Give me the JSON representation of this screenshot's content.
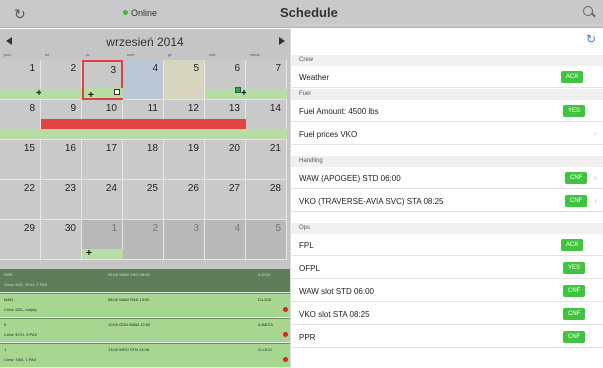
{
  "header": {
    "online_label": "Online",
    "title": "Schedule",
    "refresh_icon": "refresh-icon",
    "search_icon": "search-icon"
  },
  "calendar": {
    "month": "wrzesień 2014",
    "weekdays": [
      "pon.",
      "wt.",
      "śr.",
      "czw.",
      "pt.",
      "sob.",
      "niedz."
    ],
    "weeks": [
      [
        "1",
        "2",
        "3",
        "4",
        "5",
        "6",
        "7"
      ],
      [
        "8",
        "9",
        "10",
        "11",
        "12",
        "13",
        "14"
      ],
      [
        "15",
        "16",
        "17",
        "18",
        "19",
        "20",
        "21"
      ],
      [
        "22",
        "23",
        "24",
        "25",
        "26",
        "27",
        "28"
      ],
      [
        "29",
        "30",
        "1",
        "2",
        "3",
        "4",
        "5"
      ]
    ]
  },
  "flights": [
    {
      "reg": "RAR",
      "sub": "Crew: DEL, ECH, 2 PAX",
      "time": "06:00 WAW VKO 08:25",
      "ac": "A-EOX"
    },
    {
      "reg": "MAN",
      "sub": "Crew: DEL, empty",
      "time": "08:00 WAW RAK 13:00",
      "ac": "D-LEOI"
    },
    {
      "reg": "5",
      "sub": "Crew: ECH, 5 PAX",
      "time": "10:00 GDN WAW 12:00",
      "ac": "A-BEOX"
    },
    {
      "reg": "1",
      "sub": "Crew: TAN, 1 PAX",
      "time": "13:00 WRO STN 14:45",
      "ac": "G-LEOI"
    }
  ],
  "panel": {
    "sections": [
      {
        "title": "Crew",
        "items": [
          {
            "label": "Weather",
            "badge": "ACK"
          }
        ]
      },
      {
        "title": "Fuel",
        "items": [
          {
            "label": "Fuel Amount: 4500 lbs",
            "badge": "YES"
          },
          {
            "label": "Fuel prices VKO",
            "badge": ""
          }
        ]
      },
      {
        "title": "Handling",
        "items": [
          {
            "label": "WAW (APOGEE) STD 06:00",
            "badge": "CNF"
          },
          {
            "label": "VKO (TRAVERSE-AVIA SVC) STA 08:25",
            "badge": "CNF"
          }
        ]
      },
      {
        "title": "Ops",
        "items": [
          {
            "label": "FPL",
            "badge": "ACK"
          },
          {
            "label": "OFPL",
            "badge": "YES"
          },
          {
            "label": "WAW slot STD 06:00",
            "badge": "CNF"
          },
          {
            "label": "VKO slot STA 08:25",
            "badge": "CNF"
          },
          {
            "label": "PPR",
            "badge": "CNF"
          }
        ]
      }
    ]
  },
  "colors": {
    "badge_green": "#3ec43e",
    "accent_blue": "#3f7fe0",
    "red_event": "#e24444",
    "green_event": "#b7dca4"
  }
}
